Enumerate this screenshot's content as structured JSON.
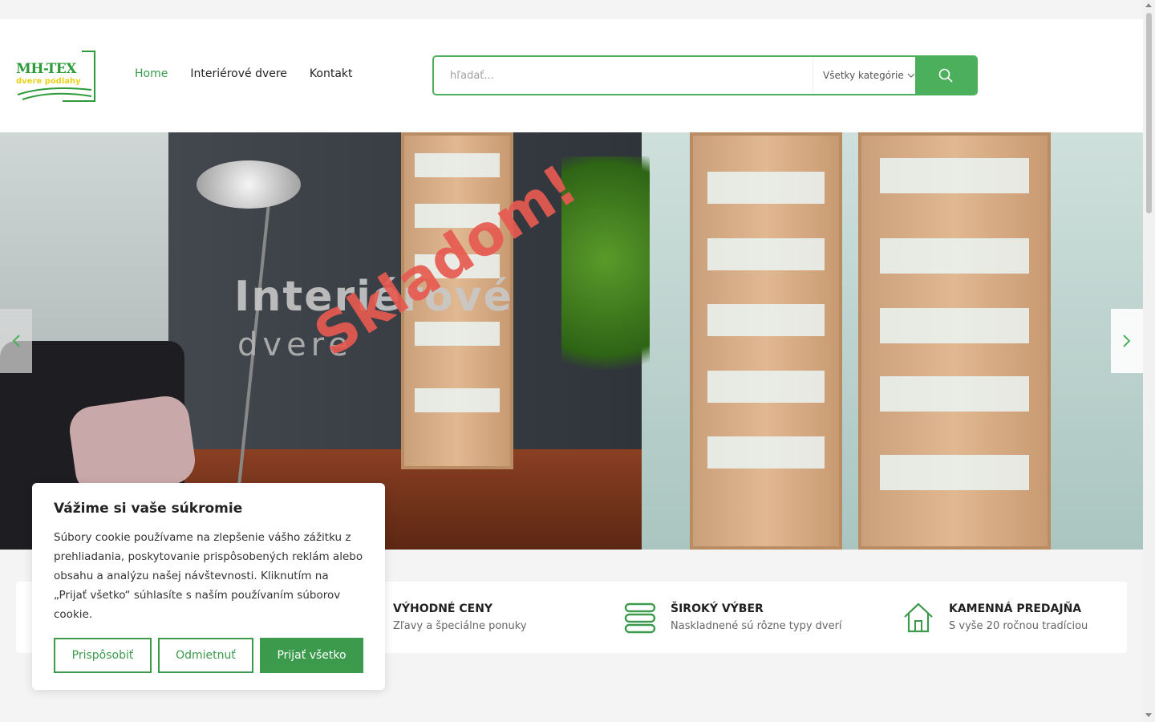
{
  "logo": {
    "line1": "MH-TEX",
    "line2": "dvere podlahy"
  },
  "nav": [
    {
      "label": "Home",
      "active": true
    },
    {
      "label": "Interiérové dvere",
      "active": false
    },
    {
      "label": "Kontakt",
      "active": false
    }
  ],
  "search": {
    "placeholder": "hľadať...",
    "category": "Všetky kategórie",
    "icon": "search-icon"
  },
  "hero": {
    "title": "Interiérové",
    "subtitle": "dvere",
    "stamp": "Skladom!"
  },
  "features": [
    {
      "icon": "tag-icon",
      "title": "VÝHODNÉ CENY",
      "desc": "Zľavy a špeciálne ponuky"
    },
    {
      "icon": "stack-icon",
      "title": "ŠIROKÝ VÝBER",
      "desc": "Naskladnené sú rôzne typy dverí"
    },
    {
      "icon": "home-icon",
      "title": "KAMENNÁ PREDAJŇA",
      "desc": "S vyše 20 ročnou tradíciou"
    }
  ],
  "cookie": {
    "title": "Vážime si vaše súkromie",
    "text": "Súbory cookie používame na zlepšenie vášho zážitku z prehliadania, poskytovanie prispôsobených reklám alebo obsahu a analýzu našej návštevnosti. Kliknutím na „Prijať všetko“ súhlasíte s naším používaním súborov cookie.",
    "customize": "Prispôsobiť",
    "reject": "Odmietnuť",
    "accept": "Prijať všetko"
  },
  "colors": {
    "accent": "#4caf5b",
    "stamp": "#e65a50"
  }
}
